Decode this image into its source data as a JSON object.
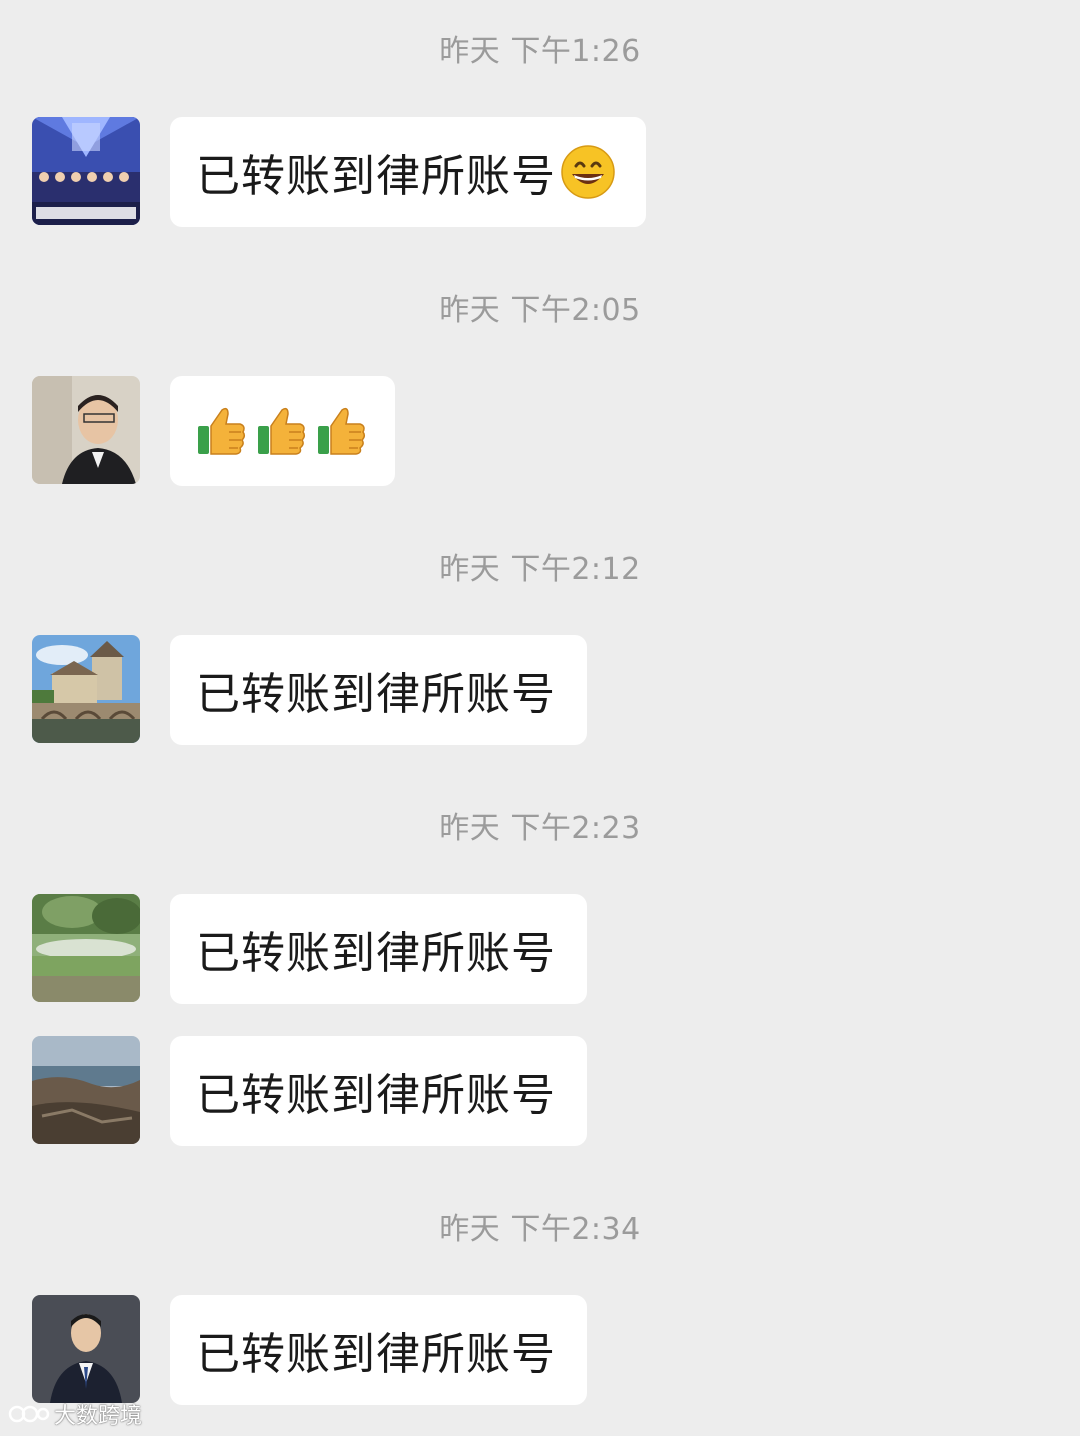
{
  "messages": [
    {
      "timestamp": "昨天 下午1:26",
      "text": "已转账到律所账号",
      "emoji": "grinning-face"
    },
    {
      "timestamp": "昨天 下午2:05",
      "emoji": "thumbs-up x3"
    },
    {
      "timestamp": "昨天 下午2:12",
      "text": "已转账到律所账号"
    },
    {
      "timestamp": "昨天 下午2:23",
      "text": "已转账到律所账号"
    },
    {
      "text": "已转账到律所账号"
    },
    {
      "timestamp": "昨天 下午2:34",
      "text": "已转账到律所账号"
    }
  ],
  "watermark": {
    "text": "大数跨境"
  },
  "colors": {
    "background": "#ededed",
    "bubble": "#ffffff",
    "timestamp": "#9b9b9b",
    "text": "#1a1a1a"
  }
}
